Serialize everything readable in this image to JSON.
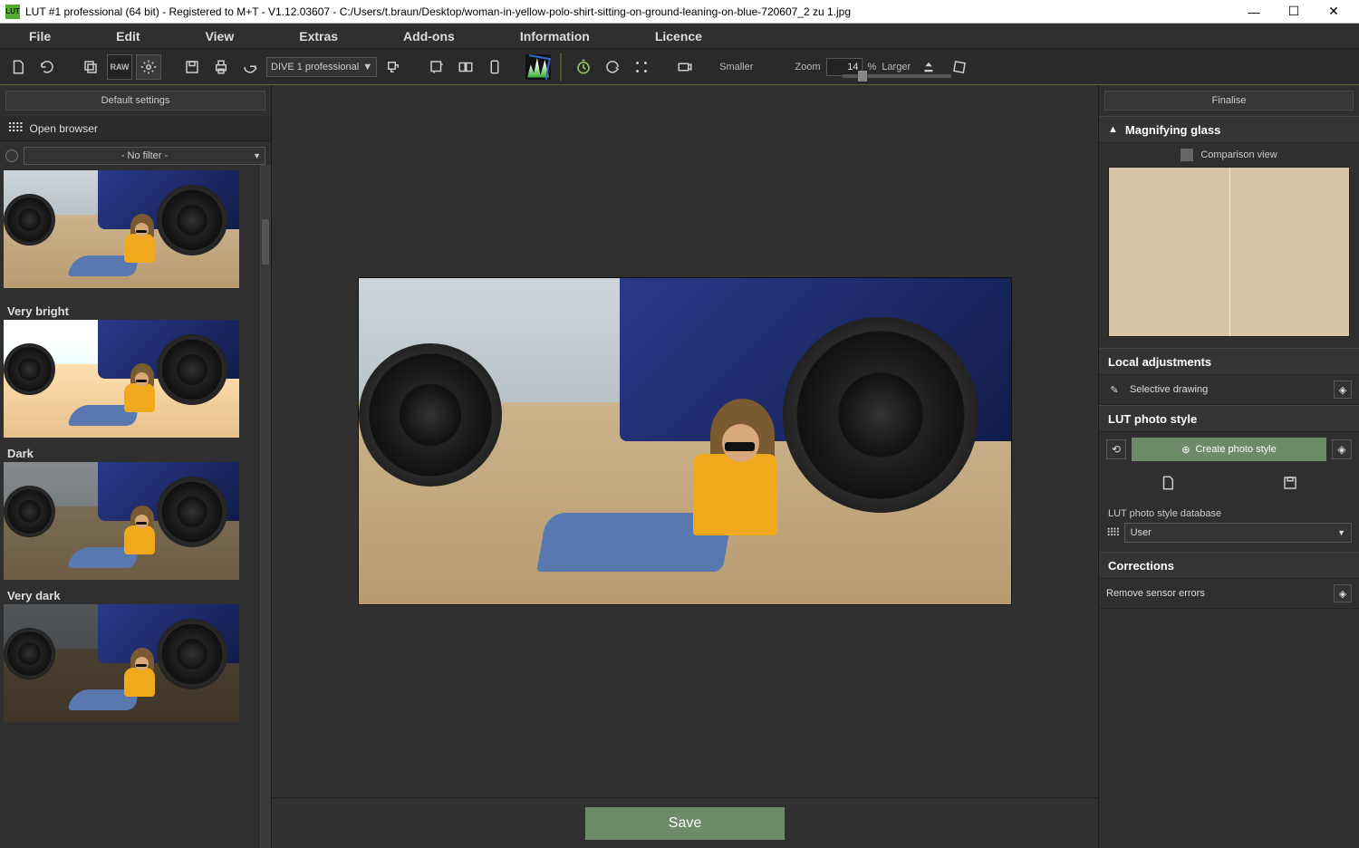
{
  "window": {
    "title": "LUT #1 professional (64 bit) - Registered to M+T - V1.12.03607 - C:/Users/t.braun/Desktop/woman-in-yellow-polo-shirt-sitting-on-ground-leaning-on-blue-720607_2 zu 1.jpg"
  },
  "menu": {
    "items": [
      "File",
      "Edit",
      "View",
      "Extras",
      "Add-ons",
      "Information",
      "Licence"
    ]
  },
  "toolbar": {
    "dive_preset": "DIVE 1 professional",
    "zoom_label": "Zoom",
    "zoom_value": "14",
    "zoom_pct": "%",
    "smaller": "Smaller",
    "larger": "Larger"
  },
  "left": {
    "default_settings": "Default settings",
    "open_browser": "Open browser",
    "filter": "- No filter -",
    "presets": [
      {
        "label": ""
      },
      {
        "label": "Very bright"
      },
      {
        "label": "Dark"
      },
      {
        "label": "Very dark"
      }
    ]
  },
  "center": {
    "save": "Save"
  },
  "right": {
    "finalise": "Finalise",
    "magnifying_glass": "Magnifying glass",
    "comparison_view": "Comparison view",
    "local_adjustments": "Local adjustments",
    "selective_drawing": "Selective drawing",
    "lut_photo_style": "LUT photo style",
    "create_photo_style": "Create photo style",
    "db_label": "LUT photo style database",
    "db_value": "User",
    "corrections": "Corrections",
    "remove_sensor": "Remove sensor errors"
  }
}
